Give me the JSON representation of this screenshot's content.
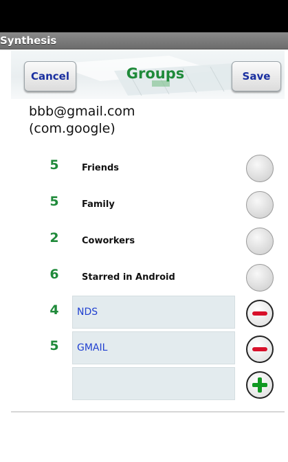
{
  "app": {
    "title": "Synthesis"
  },
  "header": {
    "title": "Groups",
    "cancel_label": "Cancel",
    "save_label": "Save"
  },
  "account": {
    "email": "bbb@gmail.com",
    "type": "(com.google)"
  },
  "fixed_groups": [
    {
      "count": "5",
      "name": "Friends"
    },
    {
      "count": "5",
      "name": "Family"
    },
    {
      "count": "2",
      "name": "Coworkers"
    },
    {
      "count": "6",
      "name": "Starred in Android"
    }
  ],
  "custom_groups": [
    {
      "count": "4",
      "name": "NDS"
    },
    {
      "count": "5",
      "name": "GMAIL"
    }
  ],
  "new_group": {
    "value": ""
  },
  "icons": {
    "empty": "empty-circle-icon",
    "remove": "remove-circle-icon",
    "add": "add-circle-icon"
  },
  "colors": {
    "accent_green": "#1f8a3a",
    "link_blue": "#1f3fd0",
    "remove_red": "#d8102a",
    "add_green": "#119922"
  }
}
